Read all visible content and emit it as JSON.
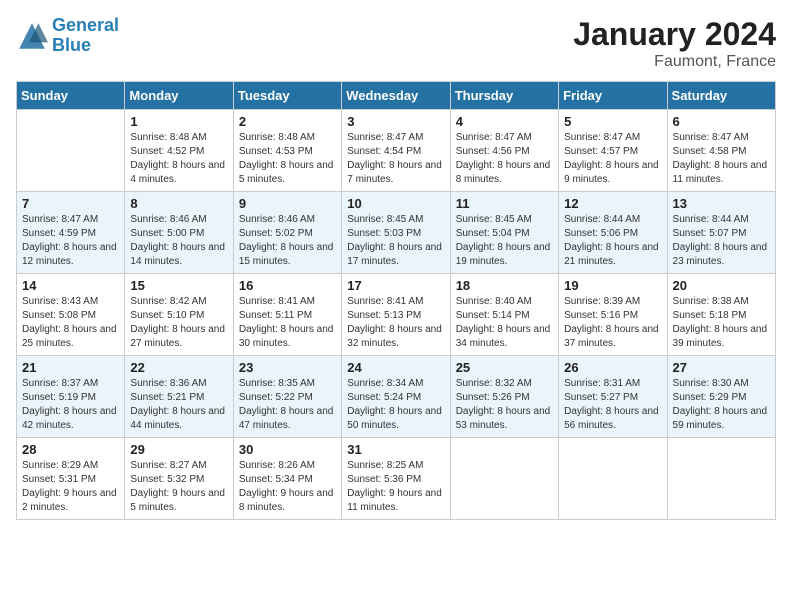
{
  "header": {
    "logo_line1": "General",
    "logo_line2": "Blue",
    "title": "January 2024",
    "subtitle": "Faumont, France"
  },
  "days_of_week": [
    "Sunday",
    "Monday",
    "Tuesday",
    "Wednesday",
    "Thursday",
    "Friday",
    "Saturday"
  ],
  "weeks": [
    [
      {
        "day": "",
        "sunrise": "",
        "sunset": "",
        "daylight": ""
      },
      {
        "day": "1",
        "sunrise": "Sunrise: 8:48 AM",
        "sunset": "Sunset: 4:52 PM",
        "daylight": "Daylight: 8 hours and 4 minutes."
      },
      {
        "day": "2",
        "sunrise": "Sunrise: 8:48 AM",
        "sunset": "Sunset: 4:53 PM",
        "daylight": "Daylight: 8 hours and 5 minutes."
      },
      {
        "day": "3",
        "sunrise": "Sunrise: 8:47 AM",
        "sunset": "Sunset: 4:54 PM",
        "daylight": "Daylight: 8 hours and 7 minutes."
      },
      {
        "day": "4",
        "sunrise": "Sunrise: 8:47 AM",
        "sunset": "Sunset: 4:56 PM",
        "daylight": "Daylight: 8 hours and 8 minutes."
      },
      {
        "day": "5",
        "sunrise": "Sunrise: 8:47 AM",
        "sunset": "Sunset: 4:57 PM",
        "daylight": "Daylight: 8 hours and 9 minutes."
      },
      {
        "day": "6",
        "sunrise": "Sunrise: 8:47 AM",
        "sunset": "Sunset: 4:58 PM",
        "daylight": "Daylight: 8 hours and 11 minutes."
      }
    ],
    [
      {
        "day": "7",
        "sunrise": "Sunrise: 8:47 AM",
        "sunset": "Sunset: 4:59 PM",
        "daylight": "Daylight: 8 hours and 12 minutes."
      },
      {
        "day": "8",
        "sunrise": "Sunrise: 8:46 AM",
        "sunset": "Sunset: 5:00 PM",
        "daylight": "Daylight: 8 hours and 14 minutes."
      },
      {
        "day": "9",
        "sunrise": "Sunrise: 8:46 AM",
        "sunset": "Sunset: 5:02 PM",
        "daylight": "Daylight: 8 hours and 15 minutes."
      },
      {
        "day": "10",
        "sunrise": "Sunrise: 8:45 AM",
        "sunset": "Sunset: 5:03 PM",
        "daylight": "Daylight: 8 hours and 17 minutes."
      },
      {
        "day": "11",
        "sunrise": "Sunrise: 8:45 AM",
        "sunset": "Sunset: 5:04 PM",
        "daylight": "Daylight: 8 hours and 19 minutes."
      },
      {
        "day": "12",
        "sunrise": "Sunrise: 8:44 AM",
        "sunset": "Sunset: 5:06 PM",
        "daylight": "Daylight: 8 hours and 21 minutes."
      },
      {
        "day": "13",
        "sunrise": "Sunrise: 8:44 AM",
        "sunset": "Sunset: 5:07 PM",
        "daylight": "Daylight: 8 hours and 23 minutes."
      }
    ],
    [
      {
        "day": "14",
        "sunrise": "Sunrise: 8:43 AM",
        "sunset": "Sunset: 5:08 PM",
        "daylight": "Daylight: 8 hours and 25 minutes."
      },
      {
        "day": "15",
        "sunrise": "Sunrise: 8:42 AM",
        "sunset": "Sunset: 5:10 PM",
        "daylight": "Daylight: 8 hours and 27 minutes."
      },
      {
        "day": "16",
        "sunrise": "Sunrise: 8:41 AM",
        "sunset": "Sunset: 5:11 PM",
        "daylight": "Daylight: 8 hours and 30 minutes."
      },
      {
        "day": "17",
        "sunrise": "Sunrise: 8:41 AM",
        "sunset": "Sunset: 5:13 PM",
        "daylight": "Daylight: 8 hours and 32 minutes."
      },
      {
        "day": "18",
        "sunrise": "Sunrise: 8:40 AM",
        "sunset": "Sunset: 5:14 PM",
        "daylight": "Daylight: 8 hours and 34 minutes."
      },
      {
        "day": "19",
        "sunrise": "Sunrise: 8:39 AM",
        "sunset": "Sunset: 5:16 PM",
        "daylight": "Daylight: 8 hours and 37 minutes."
      },
      {
        "day": "20",
        "sunrise": "Sunrise: 8:38 AM",
        "sunset": "Sunset: 5:18 PM",
        "daylight": "Daylight: 8 hours and 39 minutes."
      }
    ],
    [
      {
        "day": "21",
        "sunrise": "Sunrise: 8:37 AM",
        "sunset": "Sunset: 5:19 PM",
        "daylight": "Daylight: 8 hours and 42 minutes."
      },
      {
        "day": "22",
        "sunrise": "Sunrise: 8:36 AM",
        "sunset": "Sunset: 5:21 PM",
        "daylight": "Daylight: 8 hours and 44 minutes."
      },
      {
        "day": "23",
        "sunrise": "Sunrise: 8:35 AM",
        "sunset": "Sunset: 5:22 PM",
        "daylight": "Daylight: 8 hours and 47 minutes."
      },
      {
        "day": "24",
        "sunrise": "Sunrise: 8:34 AM",
        "sunset": "Sunset: 5:24 PM",
        "daylight": "Daylight: 8 hours and 50 minutes."
      },
      {
        "day": "25",
        "sunrise": "Sunrise: 8:32 AM",
        "sunset": "Sunset: 5:26 PM",
        "daylight": "Daylight: 8 hours and 53 minutes."
      },
      {
        "day": "26",
        "sunrise": "Sunrise: 8:31 AM",
        "sunset": "Sunset: 5:27 PM",
        "daylight": "Daylight: 8 hours and 56 minutes."
      },
      {
        "day": "27",
        "sunrise": "Sunrise: 8:30 AM",
        "sunset": "Sunset: 5:29 PM",
        "daylight": "Daylight: 8 hours and 59 minutes."
      }
    ],
    [
      {
        "day": "28",
        "sunrise": "Sunrise: 8:29 AM",
        "sunset": "Sunset: 5:31 PM",
        "daylight": "Daylight: 9 hours and 2 minutes."
      },
      {
        "day": "29",
        "sunrise": "Sunrise: 8:27 AM",
        "sunset": "Sunset: 5:32 PM",
        "daylight": "Daylight: 9 hours and 5 minutes."
      },
      {
        "day": "30",
        "sunrise": "Sunrise: 8:26 AM",
        "sunset": "Sunset: 5:34 PM",
        "daylight": "Daylight: 9 hours and 8 minutes."
      },
      {
        "day": "31",
        "sunrise": "Sunrise: 8:25 AM",
        "sunset": "Sunset: 5:36 PM",
        "daylight": "Daylight: 9 hours and 11 minutes."
      },
      {
        "day": "",
        "sunrise": "",
        "sunset": "",
        "daylight": ""
      },
      {
        "day": "",
        "sunrise": "",
        "sunset": "",
        "daylight": ""
      },
      {
        "day": "",
        "sunrise": "",
        "sunset": "",
        "daylight": ""
      }
    ]
  ]
}
